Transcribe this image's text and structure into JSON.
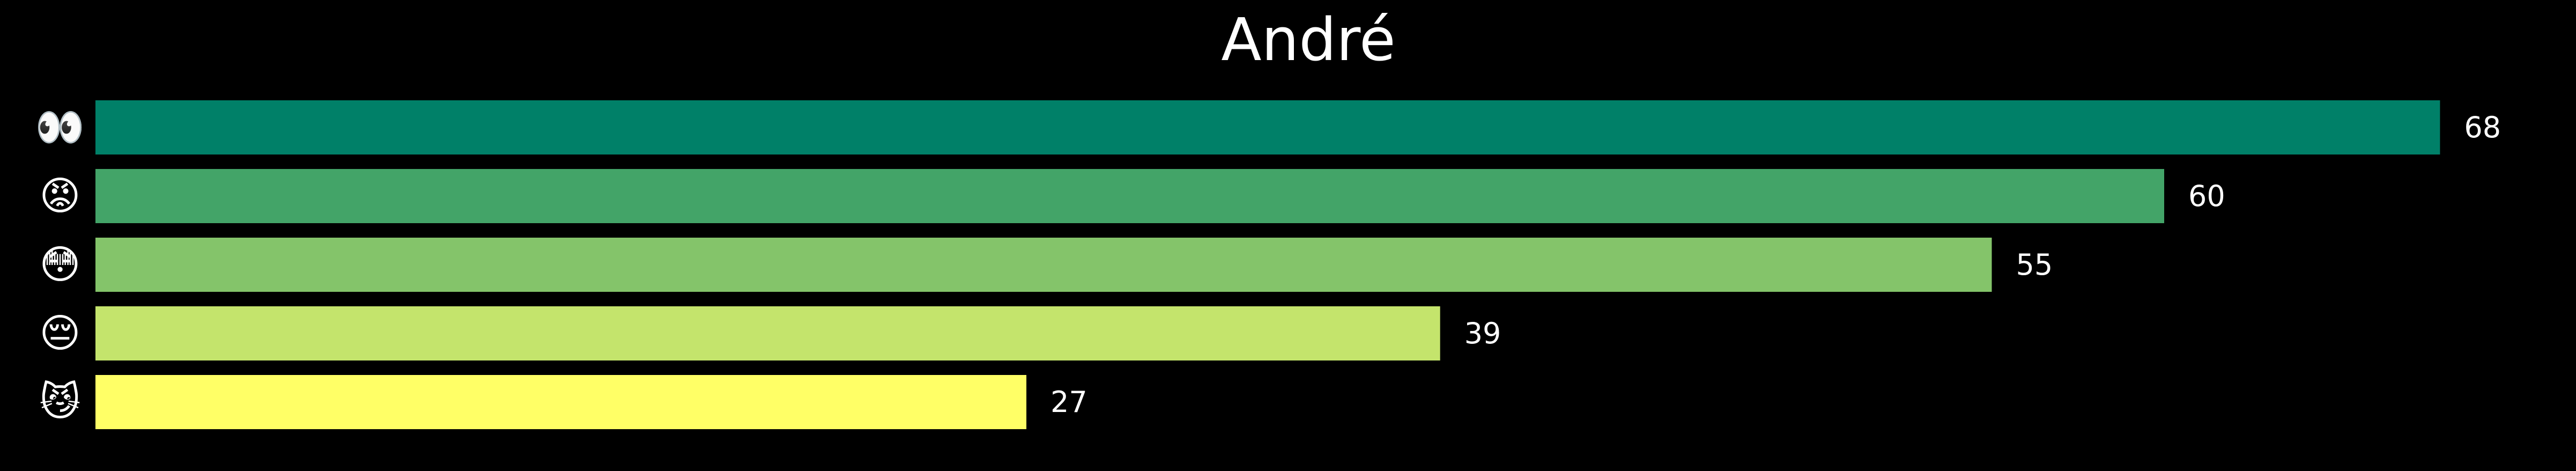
{
  "chart_data": {
    "type": "bar",
    "orientation": "horizontal",
    "title": "André",
    "categories": [
      "👀",
      "😡",
      "😳",
      "😔",
      "😼"
    ],
    "values": [
      68,
      60,
      55,
      39,
      27
    ],
    "colors": [
      "#008068",
      "#43a468",
      "#84c46a",
      "#c4e46c",
      "#ffff66"
    ],
    "xlim": [
      0,
      72
    ],
    "grid": false,
    "legend": "none",
    "background": "#000000",
    "text_color": "#ffffff"
  }
}
